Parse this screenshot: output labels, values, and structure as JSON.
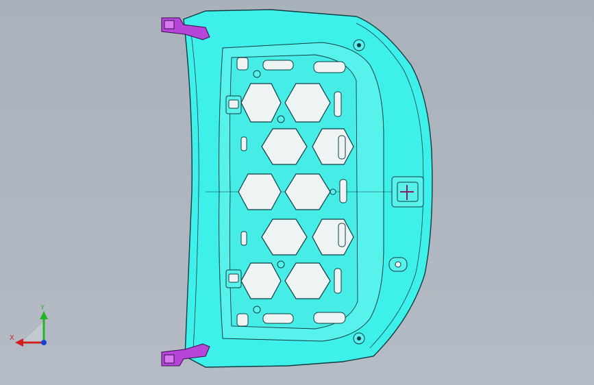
{
  "viewport": {
    "background_top": "#a9b1bb",
    "background_bottom": "#b5bcc6"
  },
  "part": {
    "body_color": "#3ef0ea",
    "edge_color": "#0f3c40",
    "hole_color": "#eef3f4",
    "hinge_color": "#b646d9"
  },
  "triad": {
    "x_label": "X",
    "y_label": "Y",
    "x_color": "#d1201b",
    "y_color": "#27b22c",
    "z_color": "#1d3fd6"
  }
}
